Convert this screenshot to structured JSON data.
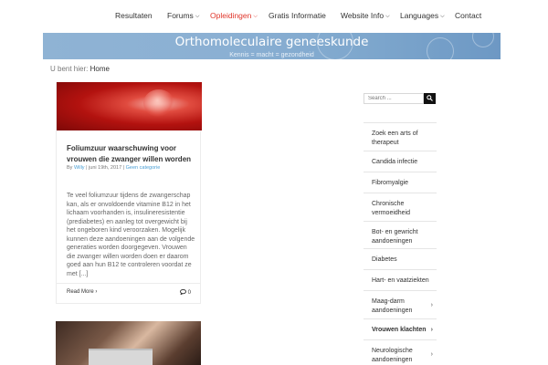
{
  "nav": {
    "items": [
      {
        "label": "Resultaten",
        "has_caret": false,
        "active": false
      },
      {
        "label": "Forums",
        "has_caret": true,
        "active": false
      },
      {
        "label": "Opleidingen",
        "has_caret": true,
        "active": true
      },
      {
        "label": "Gratis Informatie",
        "has_caret": false,
        "active": false
      },
      {
        "label": "Website Info",
        "has_caret": true,
        "active": false
      },
      {
        "label": "Languages",
        "has_caret": true,
        "active": false
      },
      {
        "label": "Contact",
        "has_caret": false,
        "active": false
      }
    ],
    "active_color": "#e0362b"
  },
  "banner": {
    "title": "Orthomoleculaire geneeskunde",
    "subtitle": "Kennis = macht = gezondheid"
  },
  "breadcrumb": {
    "prefix": "U bent hier:",
    "current": "Home"
  },
  "post": {
    "title": "Foliumzuur waarschuwing voor vrouwen die zwanger willen worden",
    "meta_by": "By",
    "author": "Willy",
    "sep1": "|",
    "date": "juni 19th, 2017",
    "sep2": "|",
    "category": "Geen categorie",
    "excerpt": "Te veel foliumzuur tijdens de zwangerschap kan, als er onvoldoende vitamine B12 in het lichaam voorhanden is, insulineresistentie (prediabetes) en aanleg tot overgewicht bij het ongeboren kind veroorzaken. Mogelijk kunnen deze aandoeningen aan de volgende generaties worden doorgegeven. Vrouwen die zwanger willen worden doen er daarom goed aan hun B12 te controleren voordat ze met [...]",
    "read_more": "Read More",
    "comments_count": "0"
  },
  "search": {
    "placeholder": "Search ..."
  },
  "sidebar": {
    "items": [
      {
        "label": "Zoek een arts of therapeut",
        "arrow": false,
        "bold": false
      },
      {
        "label": "Candida infectie",
        "arrow": false,
        "bold": false
      },
      {
        "label": "Fibromyalgie",
        "arrow": false,
        "bold": false
      },
      {
        "label": "Chronische vermoeidheid",
        "arrow": false,
        "bold": false
      },
      {
        "label": "Bot- en gewricht aandoeningen",
        "arrow": false,
        "bold": false
      },
      {
        "label": "Diabetes",
        "arrow": false,
        "bold": false
      },
      {
        "label": "Hart- en vaatziekten",
        "arrow": false,
        "bold": false
      },
      {
        "label": "Maag-darm aandoeningen",
        "arrow": true,
        "bold": false
      },
      {
        "label": "Vrouwen klachten",
        "arrow": true,
        "bold": true
      },
      {
        "label": "Neurologische aandoeningen",
        "arrow": true,
        "bold": false
      }
    ]
  }
}
